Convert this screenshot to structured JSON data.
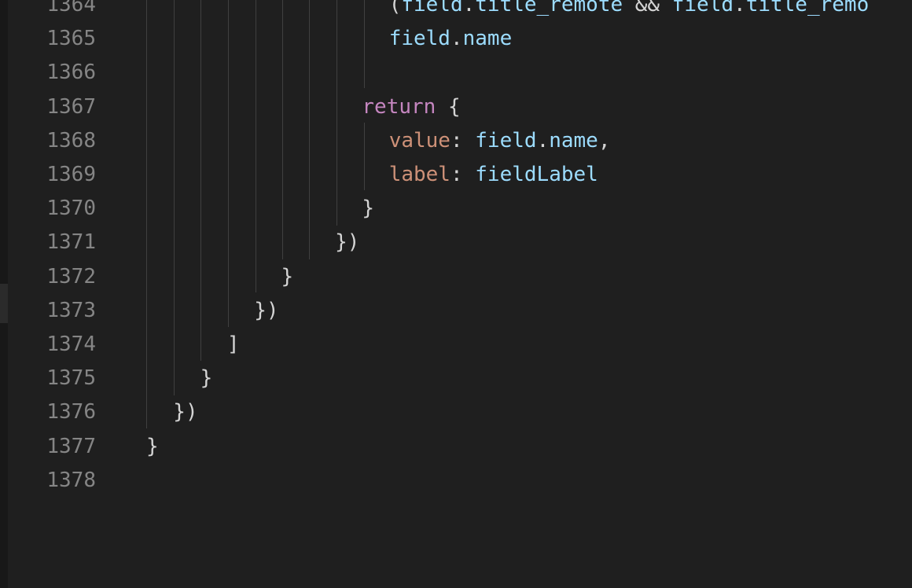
{
  "editor": {
    "lines": [
      {
        "number": "1364",
        "tokens": [
          [
            "(",
            "punc"
          ],
          [
            "field",
            "var"
          ],
          [
            ".",
            "punc"
          ],
          [
            "title_remote",
            "var"
          ],
          [
            " && ",
            "punc"
          ],
          [
            "field",
            "var"
          ],
          [
            ".",
            "punc"
          ],
          [
            "title_remo",
            "var"
          ]
        ]
      },
      {
        "number": "1365",
        "tokens": [
          [
            "field",
            "var"
          ],
          [
            ".",
            "punc"
          ],
          [
            "name",
            "var"
          ]
        ]
      },
      {
        "number": "1366",
        "tokens": []
      },
      {
        "number": "1367",
        "tokens": [
          [
            "return",
            "kw"
          ],
          [
            " {",
            "punc"
          ]
        ]
      },
      {
        "number": "1368",
        "tokens": [
          [
            "value",
            "prop"
          ],
          [
            ": ",
            "punc"
          ],
          [
            "field",
            "var"
          ],
          [
            ".",
            "punc"
          ],
          [
            "name",
            "var"
          ],
          [
            ",",
            "punc"
          ]
        ]
      },
      {
        "number": "1369",
        "tokens": [
          [
            "label",
            "prop"
          ],
          [
            ": ",
            "punc"
          ],
          [
            "fieldLabel",
            "var"
          ]
        ]
      },
      {
        "number": "1370",
        "tokens": [
          [
            "}",
            "punc"
          ]
        ]
      },
      {
        "number": "1371",
        "tokens": [
          [
            "})",
            "punc"
          ]
        ]
      },
      {
        "number": "1372",
        "tokens": [
          [
            "}",
            "punc"
          ]
        ]
      },
      {
        "number": "1373",
        "tokens": [
          [
            "})",
            "punc"
          ]
        ]
      },
      {
        "number": "1374",
        "tokens": [
          [
            "]",
            "punc"
          ]
        ]
      },
      {
        "number": "1375",
        "tokens": [
          [
            "}",
            "punc"
          ]
        ]
      },
      {
        "number": "1376",
        "tokens": [
          [
            "})",
            "punc"
          ]
        ]
      },
      {
        "number": "1377",
        "tokens": [
          [
            "}",
            "punc"
          ]
        ]
      },
      {
        "number": "1378",
        "tokens": []
      }
    ]
  },
  "colors": {
    "background": "#1f1f1f",
    "line_number": "#858585",
    "keyword": "#c586c0",
    "property": "#ce9178",
    "variable": "#9cdcfe",
    "punctuation": "#d4d4d4",
    "indent_guide": "#404040"
  }
}
